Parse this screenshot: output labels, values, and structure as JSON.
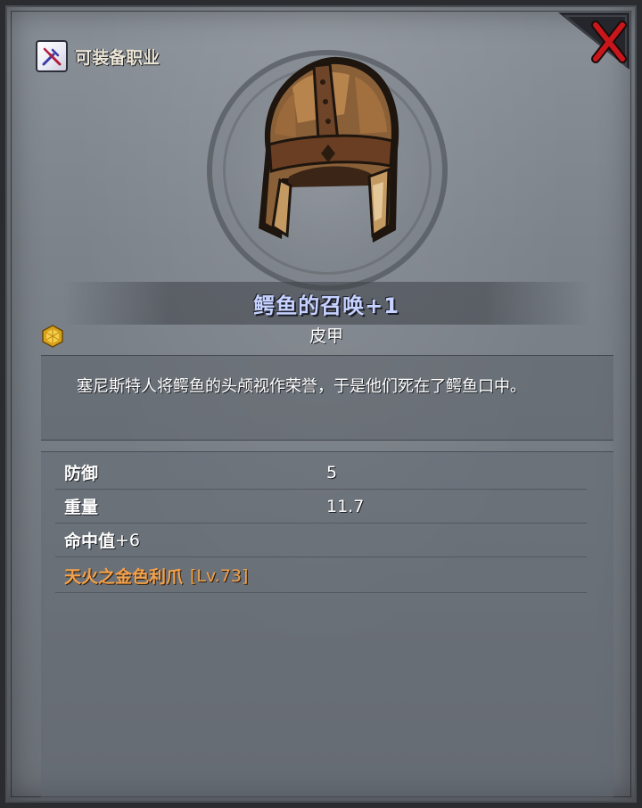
{
  "header": {
    "class_label": "可装备职业",
    "class_icon": "crossed-weapons-icon",
    "close_icon": "close-x-icon"
  },
  "item": {
    "image_icon": "leather-helmet-icon",
    "title": "鳄鱼的召唤+1",
    "grade_icon": "gold-gem-icon",
    "type": "皮甲",
    "description": "塞尼斯特人将鳄鱼的头颅视作荣誉，于是他们死在了鳄鱼口中。"
  },
  "stats": [
    {
      "label": "防御",
      "value": "5"
    },
    {
      "label": "重量",
      "value": "11.7"
    }
  ],
  "bonus": {
    "label": "命中值",
    "value": "+6"
  },
  "set": {
    "name": "天火之金色利爪",
    "level": "[Lv.73]"
  },
  "colors": {
    "title": "#c6d2ff",
    "set_name": "#f3a14a",
    "close": "#c8161b"
  }
}
